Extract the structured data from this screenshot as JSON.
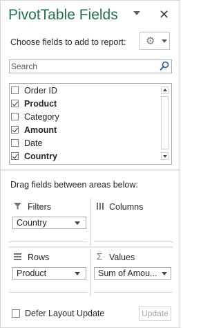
{
  "panel": {
    "title": "PivotTable Fields",
    "choose_label": "Choose fields to add to report:",
    "icons": {
      "title_dropdown": "chevron-down-icon",
      "close": "close-icon",
      "settings": "gear-icon",
      "search": "search-icon"
    }
  },
  "search": {
    "placeholder": "Search",
    "value": ""
  },
  "fields": [
    {
      "label": "Order ID",
      "checked": false
    },
    {
      "label": "Product",
      "checked": true
    },
    {
      "label": "Category",
      "checked": false
    },
    {
      "label": "Amount",
      "checked": true
    },
    {
      "label": "Date",
      "checked": false
    },
    {
      "label": "Country",
      "checked": true
    }
  ],
  "areas": {
    "drag_label": "Drag fields between areas below:",
    "filters": {
      "label": "Filters",
      "icon": "filter-icon",
      "items": [
        "Country"
      ]
    },
    "columns": {
      "label": "Columns",
      "icon": "columns-icon",
      "items": []
    },
    "rows": {
      "label": "Rows",
      "icon": "rows-icon",
      "items": [
        "Product"
      ]
    },
    "values": {
      "label": "Values",
      "icon": "sigma-icon",
      "items": [
        "Sum of Amou..."
      ]
    }
  },
  "footer": {
    "defer_label": "Defer Layout Update",
    "defer_checked": false,
    "update_label": "Update"
  },
  "colors": {
    "title": "#217346",
    "border": "#ababab",
    "text": "#262626",
    "disabled_text": "#a6a6a6"
  }
}
